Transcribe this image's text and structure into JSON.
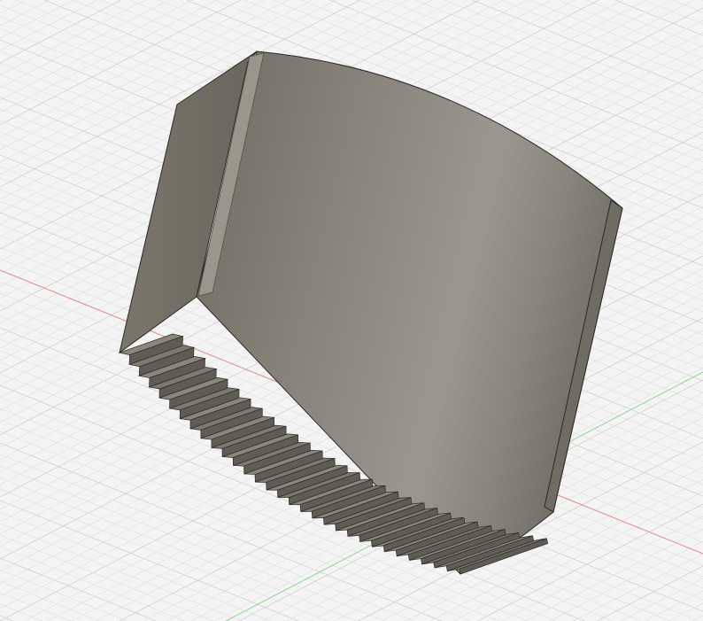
{
  "viewport": {
    "view": "3d-model",
    "colors": {
      "background": "#f4f4f4",
      "grid_minor": "#e2e2e2",
      "grid_major": "#d2d2d2",
      "axis_x": "#e07070",
      "axis_y": "#7ccf7c",
      "body_light": "#8e8a80",
      "body_dark": "#6b675e",
      "edge": "#2a2a2a"
    }
  }
}
